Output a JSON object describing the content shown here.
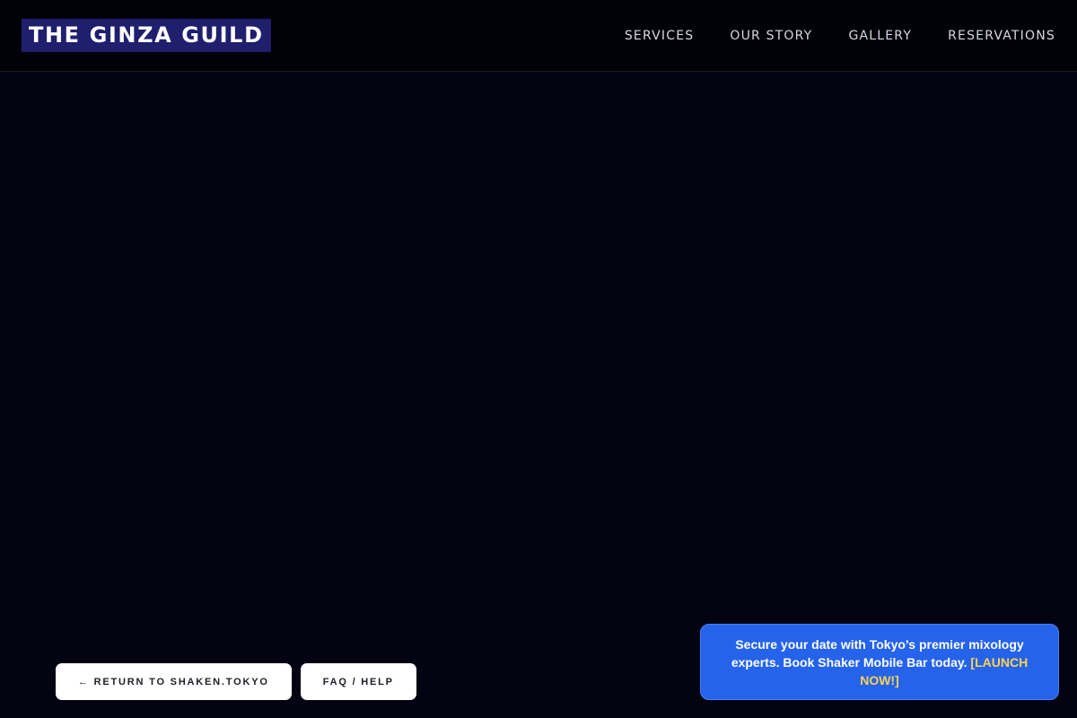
{
  "header": {
    "logo": "THE GINZA GUILD",
    "nav": [
      {
        "label": "SERVICES"
      },
      {
        "label": "OUR STORY"
      },
      {
        "label": "GALLERY"
      },
      {
        "label": "RESERVATIONS"
      }
    ]
  },
  "footer_buttons": {
    "return_label": "← RETURN TO SHAKEN.TOKYO",
    "faq_label": "FAQ / HELP"
  },
  "promo": {
    "message": "Secure your date with Tokyo’s premier mixology experts. Book Shaker Mobile Bar today.",
    "link_label": "[LAUNCH NOW!]"
  },
  "colors": {
    "background": "#030312",
    "logo_bg": "#1f1f6e",
    "promo_bg": "#2563eb",
    "promo_link": "#fcd34d"
  }
}
